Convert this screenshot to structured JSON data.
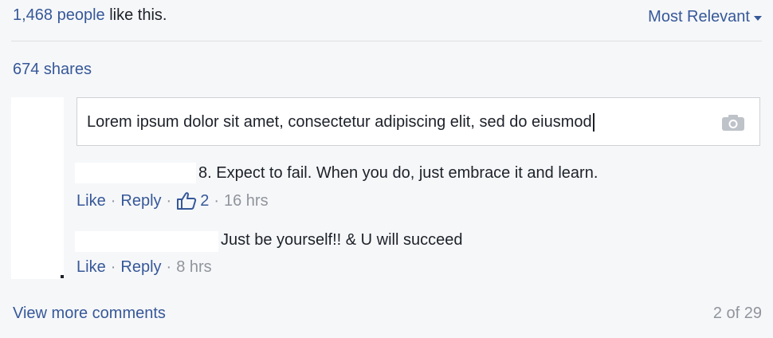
{
  "likes": {
    "count_link": "1,468 people",
    "suffix": " like this."
  },
  "sort": {
    "label": "Most Relevant"
  },
  "shares": {
    "label": "674 shares"
  },
  "composer": {
    "value": "Lorem ipsum dolor sit amet, consectetur adipiscing elit, sed do eiusmod",
    "icon": "camera-icon"
  },
  "comments": [
    {
      "text": "8. Expect to fail. When you do, just embrace it and learn.",
      "like_label": "Like",
      "reply_label": "Reply",
      "reaction_count": "2",
      "time": "16 hrs"
    },
    {
      "text": "Just be yourself!! & U will succeed",
      "like_label": "Like",
      "reply_label": "Reply",
      "time": "8 hrs"
    }
  ],
  "footer": {
    "view_more": "View more comments",
    "pager": "2 of 29"
  },
  "colors": {
    "link": "#365899",
    "muted": "#90949c",
    "text": "#1d2129",
    "background": "#f6f7f9"
  }
}
